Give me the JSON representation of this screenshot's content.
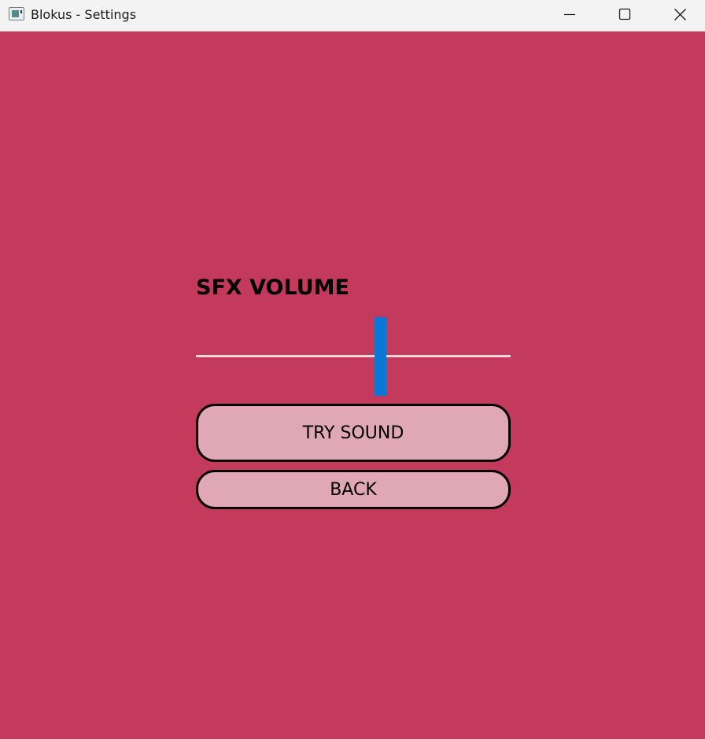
{
  "window": {
    "title": "Blokus - Settings",
    "background_color": "#c33a5c",
    "controls": {
      "minimize_icon": "minimize-icon",
      "maximize_icon": "maximize-icon",
      "close_icon": "close-icon"
    }
  },
  "settings": {
    "sfx_label": "SFX VOLUME",
    "sfx_volume": {
      "value": 0.59,
      "min": 0,
      "max": 1,
      "thumb_color": "#0a78d4",
      "track_color": "#f2d6dd"
    },
    "try_sound_label": "TRY SOUND",
    "back_label": "BACK",
    "button_color": "#e0a7b4"
  }
}
